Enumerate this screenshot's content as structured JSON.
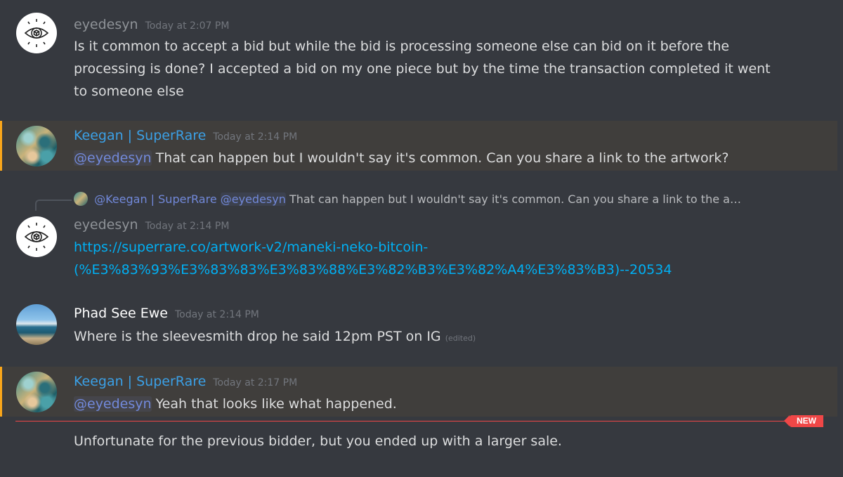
{
  "messages": [
    {
      "author": "eyedesyn",
      "timestamp": "Today at 2:07 PM",
      "text": "Is it common to accept a bid but while the bid is processing someone else can bid on it before the processing is done? I accepted a bid on my one piece but by the time the transaction completed it went to someone else",
      "name_color": "#8e9297"
    },
    {
      "author": "Keegan | SuperRare",
      "timestamp": "Today at 2:14 PM",
      "mention": "@eyedesyn",
      "text": " That can happen but I wouldn't say it's common.   Can you share a link to the artwork?",
      "name_color": "#3ba0e6"
    },
    {
      "reply": {
        "author": "@Keegan | SuperRare",
        "mention": "@eyedesyn",
        "text": "That can happen but I wouldn't say it's common.   Can you share a link to the a…"
      },
      "author": "eyedesyn",
      "timestamp": "Today at 2:14 PM",
      "link_line1": "https://superrare.co/artwork-v2/maneki-neko-bitcoin-",
      "link_line2": "(%E3%83%93%E3%83%83%E3%83%88%E3%82%B3%E3%82%A4%E3%83%B3)--20534",
      "name_color": "#8e9297"
    },
    {
      "author": "Phad See Ewe",
      "timestamp": "Today at 2:14 PM",
      "text": "Where is the sleevesmith drop he said 12pm PST on IG",
      "edited": "(edited)",
      "name_color": "#ffffff"
    },
    {
      "author": "Keegan | SuperRare",
      "timestamp": "Today at 2:17 PM",
      "mention": "@eyedesyn",
      "text": " Yeah that looks like what happened.",
      "name_color": "#3ba0e6"
    }
  ],
  "followup": "Unfortunate for the previous bidder, but you ended up with a larger sale.",
  "new_badge": "NEW",
  "colors": {
    "background": "#36393f",
    "highlight": "#403e3c",
    "highlight_bar": "#faa61a",
    "mention": "#7289da",
    "link": "#00b0f4",
    "new_divider": "#f04747"
  }
}
